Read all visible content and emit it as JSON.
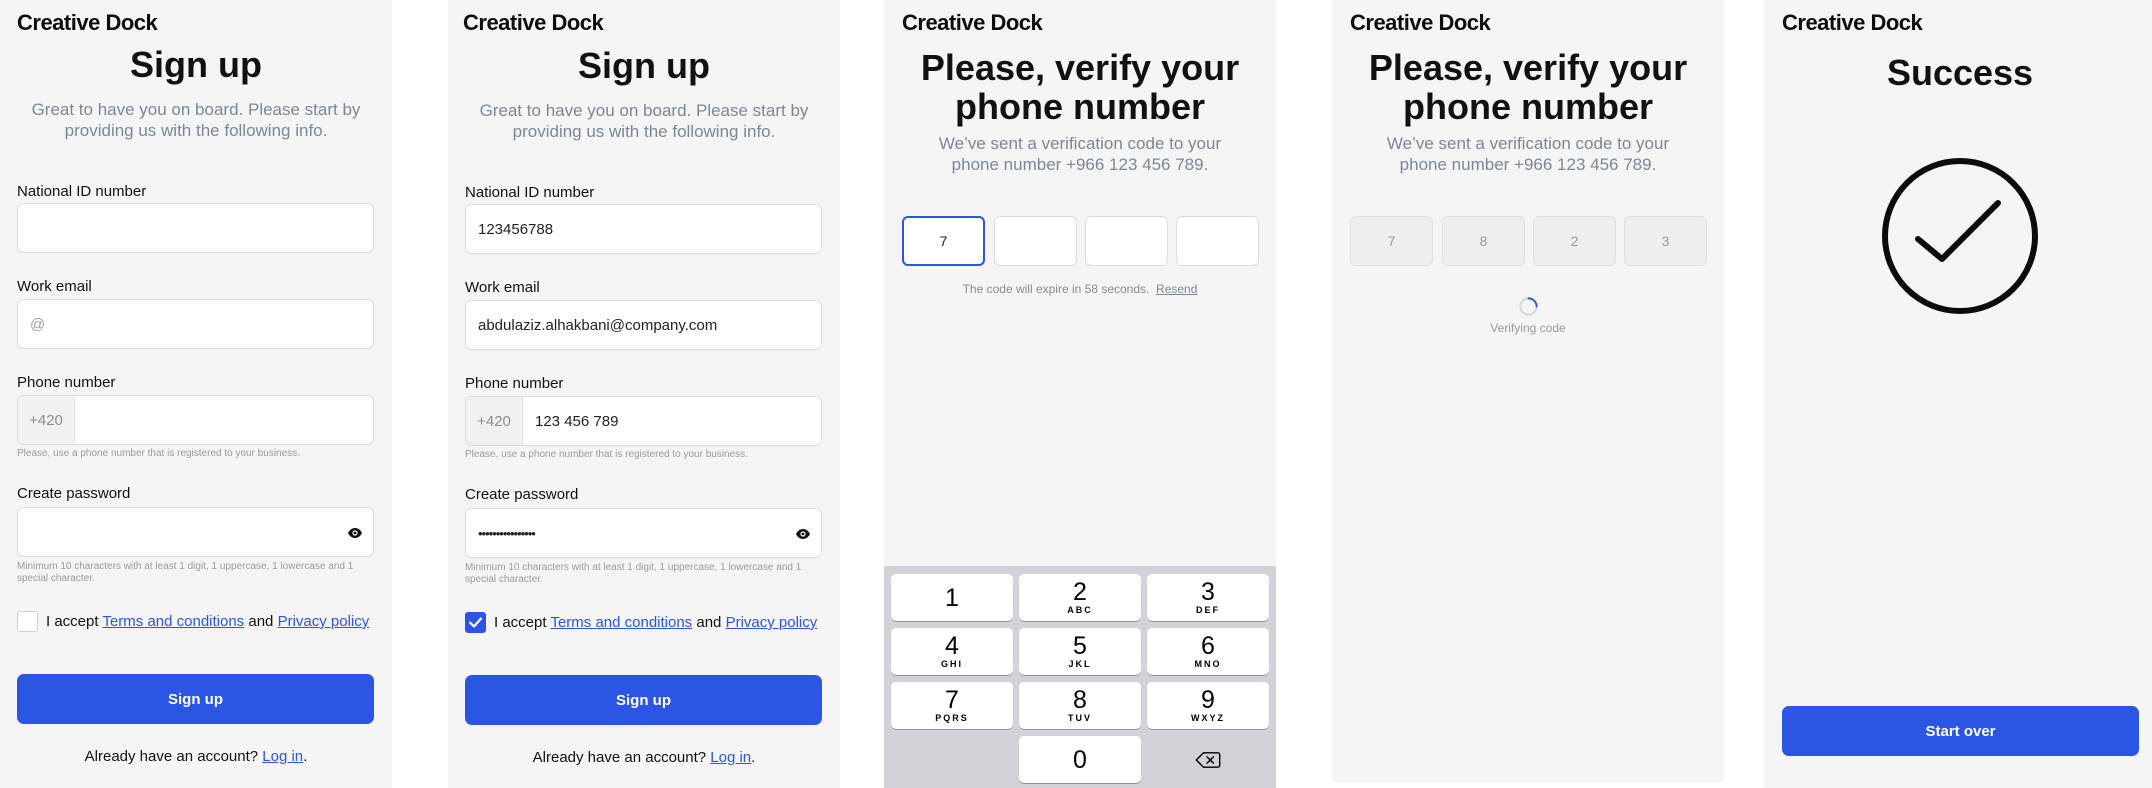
{
  "brand": "Creative Dock",
  "signup_empty": {
    "title": "Sign up",
    "subtitle": "Great to have you on board. Please start by providing us with the following info.",
    "national_id_label": "National ID number",
    "national_id_value": "",
    "email_label": "Work email",
    "email_placeholder": "@",
    "phone_label": "Phone number",
    "phone_prefix": "+420",
    "phone_value": "",
    "phone_hint": "Please, use a phone number that is registered to your business.",
    "password_label": "Create password",
    "password_value": "",
    "password_hint": "Minimum 10 characters with at least 1 digit, 1 uppercase, 1 lowercase and 1 special character.",
    "accept_prefix": "I accept",
    "terms_link": "Terms and conditions",
    "and_text": "and",
    "privacy_link": "Privacy policy",
    "checked": false,
    "submit_label": "Sign up",
    "already_text": "Already have an account?",
    "login_link": "Log in",
    "period": "."
  },
  "signup_filled": {
    "title": "Sign up",
    "subtitle": "Great to have you on board. Please start by providing us with the following info.",
    "national_id_label": "National ID number",
    "national_id_value": "123456788",
    "email_label": "Work email",
    "email_value": "abdulaziz.alhakbani@company.com",
    "phone_label": "Phone number",
    "phone_prefix": "+420",
    "phone_value": "123 456 789",
    "phone_hint": "Please, use a phone number that is registered to your business.",
    "password_label": "Create password",
    "password_value": "••••••••••••••••",
    "password_hint": "Minimum 10 characters with at least 1 digit, 1 uppercase, 1 lowercase and 1 special character.",
    "accept_prefix": "I accept",
    "terms_link": "Terms and conditions",
    "and_text": "and",
    "privacy_link": "Privacy policy",
    "checked": true,
    "submit_label": "Sign up",
    "already_text": "Already have an account?",
    "login_link": "Log in",
    "period": "."
  },
  "verify_entry": {
    "title_line1": "Please, verify your",
    "title_line2": "phone number",
    "subtitle_line1": "We’ve sent a verification code to your",
    "subtitle_line2": "phone number +966 123 456 789.",
    "code": [
      "7",
      "",
      "",
      ""
    ],
    "expire_text": "The code will expire in 58 seconds.",
    "resend_link": "Resend",
    "keys": [
      {
        "digit": "1",
        "letters": ""
      },
      {
        "digit": "2",
        "letters": "ABC"
      },
      {
        "digit": "3",
        "letters": "DEF"
      },
      {
        "digit": "4",
        "letters": "GHI"
      },
      {
        "digit": "5",
        "letters": "JKL"
      },
      {
        "digit": "6",
        "letters": "MNO"
      },
      {
        "digit": "7",
        "letters": "PQRS"
      },
      {
        "digit": "8",
        "letters": "TUV"
      },
      {
        "digit": "9",
        "letters": "WXYZ"
      },
      {
        "digit": "0",
        "letters": ""
      }
    ]
  },
  "verify_progress": {
    "title_line1": "Please, verify your",
    "title_line2": "phone number",
    "subtitle_line1": "We’ve sent a verification code to your",
    "subtitle_line2": "phone number +966 123 456 789.",
    "code": [
      "7",
      "8",
      "2",
      "3"
    ],
    "status_text": "Verifying code"
  },
  "success": {
    "title": "Success",
    "button_label": "Start over"
  },
  "colors": {
    "accent": "#2a55e5",
    "screen_bg": "#f5f5f5",
    "subtitle": "#7b8797"
  }
}
